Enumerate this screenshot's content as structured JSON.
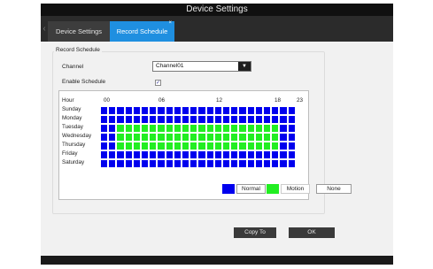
{
  "window": {
    "title": "Device Settings"
  },
  "tabs": [
    {
      "label": "Device Settings",
      "active": false
    },
    {
      "label": "Record Schedule",
      "active": true,
      "close_glyph": "×"
    }
  ],
  "nav": {
    "prev_glyph": "‹"
  },
  "record_schedule": {
    "group_title": "Record Schedule",
    "channel_label": "Channel",
    "channel_value": "Channel01",
    "enable_label": "Enable Schedule",
    "enable_checked": true,
    "hour_header": "Hour",
    "hour_ticks": [
      "00",
      "06",
      "12",
      "18",
      "23"
    ],
    "days": [
      "Sunday",
      "Monday",
      "Tuesday",
      "Wednesday",
      "Thursday",
      "Friday",
      "Saturday"
    ],
    "schedule": [
      [
        "N",
        "N",
        "N",
        "N",
        "N",
        "N",
        "N",
        "N",
        "N",
        "N",
        "N",
        "N",
        "N",
        "N",
        "N",
        "N",
        "N",
        "N",
        "N",
        "N",
        "N",
        "N",
        "N",
        "N"
      ],
      [
        "N",
        "N",
        "N",
        "N",
        "N",
        "N",
        "N",
        "N",
        "N",
        "N",
        "N",
        "N",
        "N",
        "N",
        "N",
        "N",
        "N",
        "N",
        "N",
        "N",
        "N",
        "N",
        "N",
        "N"
      ],
      [
        "N",
        "N",
        "M",
        "M",
        "M",
        "M",
        "M",
        "M",
        "M",
        "M",
        "M",
        "M",
        "M",
        "M",
        "M",
        "M",
        "M",
        "M",
        "M",
        "M",
        "M",
        "M",
        "N",
        "N"
      ],
      [
        "N",
        "N",
        "M",
        "M",
        "M",
        "M",
        "M",
        "M",
        "M",
        "M",
        "M",
        "M",
        "M",
        "M",
        "M",
        "M",
        "M",
        "M",
        "M",
        "M",
        "M",
        "M",
        "N",
        "N"
      ],
      [
        "N",
        "N",
        "M",
        "M",
        "M",
        "M",
        "M",
        "M",
        "M",
        "M",
        "M",
        "M",
        "M",
        "M",
        "M",
        "M",
        "M",
        "M",
        "M",
        "M",
        "M",
        "M",
        "N",
        "N"
      ],
      [
        "N",
        "N",
        "N",
        "N",
        "N",
        "N",
        "N",
        "N",
        "N",
        "N",
        "N",
        "N",
        "N",
        "N",
        "N",
        "N",
        "N",
        "N",
        "N",
        "N",
        "N",
        "N",
        "N",
        "N"
      ],
      [
        "N",
        "N",
        "N",
        "N",
        "N",
        "N",
        "N",
        "N",
        "N",
        "N",
        "N",
        "N",
        "N",
        "N",
        "N",
        "N",
        "N",
        "N",
        "N",
        "N",
        "N",
        "N",
        "N",
        "N"
      ]
    ],
    "legend": [
      {
        "label": "Normal",
        "color": "#0000ee"
      },
      {
        "label": "Motion",
        "color": "#22ee22"
      },
      {
        "label": "None",
        "color": "#ffffff"
      }
    ]
  },
  "buttons": {
    "copy_to": "Copy To",
    "ok": "OK"
  },
  "colors": {
    "tab_active": "#1f8fe0",
    "titlebar": "#101010",
    "normal": "#0000ee",
    "motion": "#22ee22"
  },
  "icons": {
    "dropdown": "chevron-down-icon",
    "checkbox": "checkmark-icon",
    "close": "close-icon"
  }
}
